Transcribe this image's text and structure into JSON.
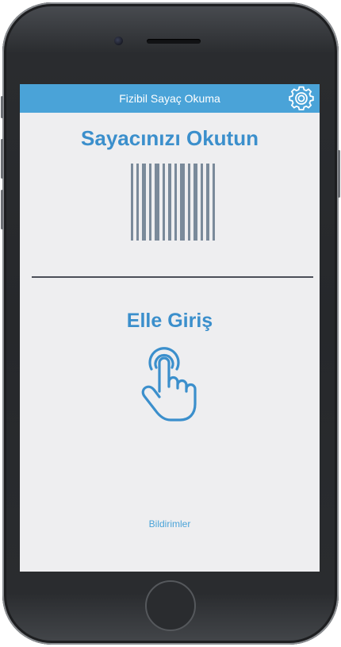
{
  "app": {
    "title": "Fizibil Sayaç Okuma"
  },
  "scan_section": {
    "title": "Sayacınızı Okutun",
    "icon": "barcode-icon"
  },
  "manual_section": {
    "title": "Elle Giriş",
    "icon": "hand-tap-icon"
  },
  "footer": {
    "notifications_label": "Bildirimler"
  },
  "header_icons": {
    "settings": "gear-icon"
  },
  "colors": {
    "accent": "#4aa3d8",
    "heading": "#3b8fcc",
    "screen_bg": "#eeeef0",
    "barcode": "#7a8a9a",
    "divider": "#4b4f58"
  }
}
